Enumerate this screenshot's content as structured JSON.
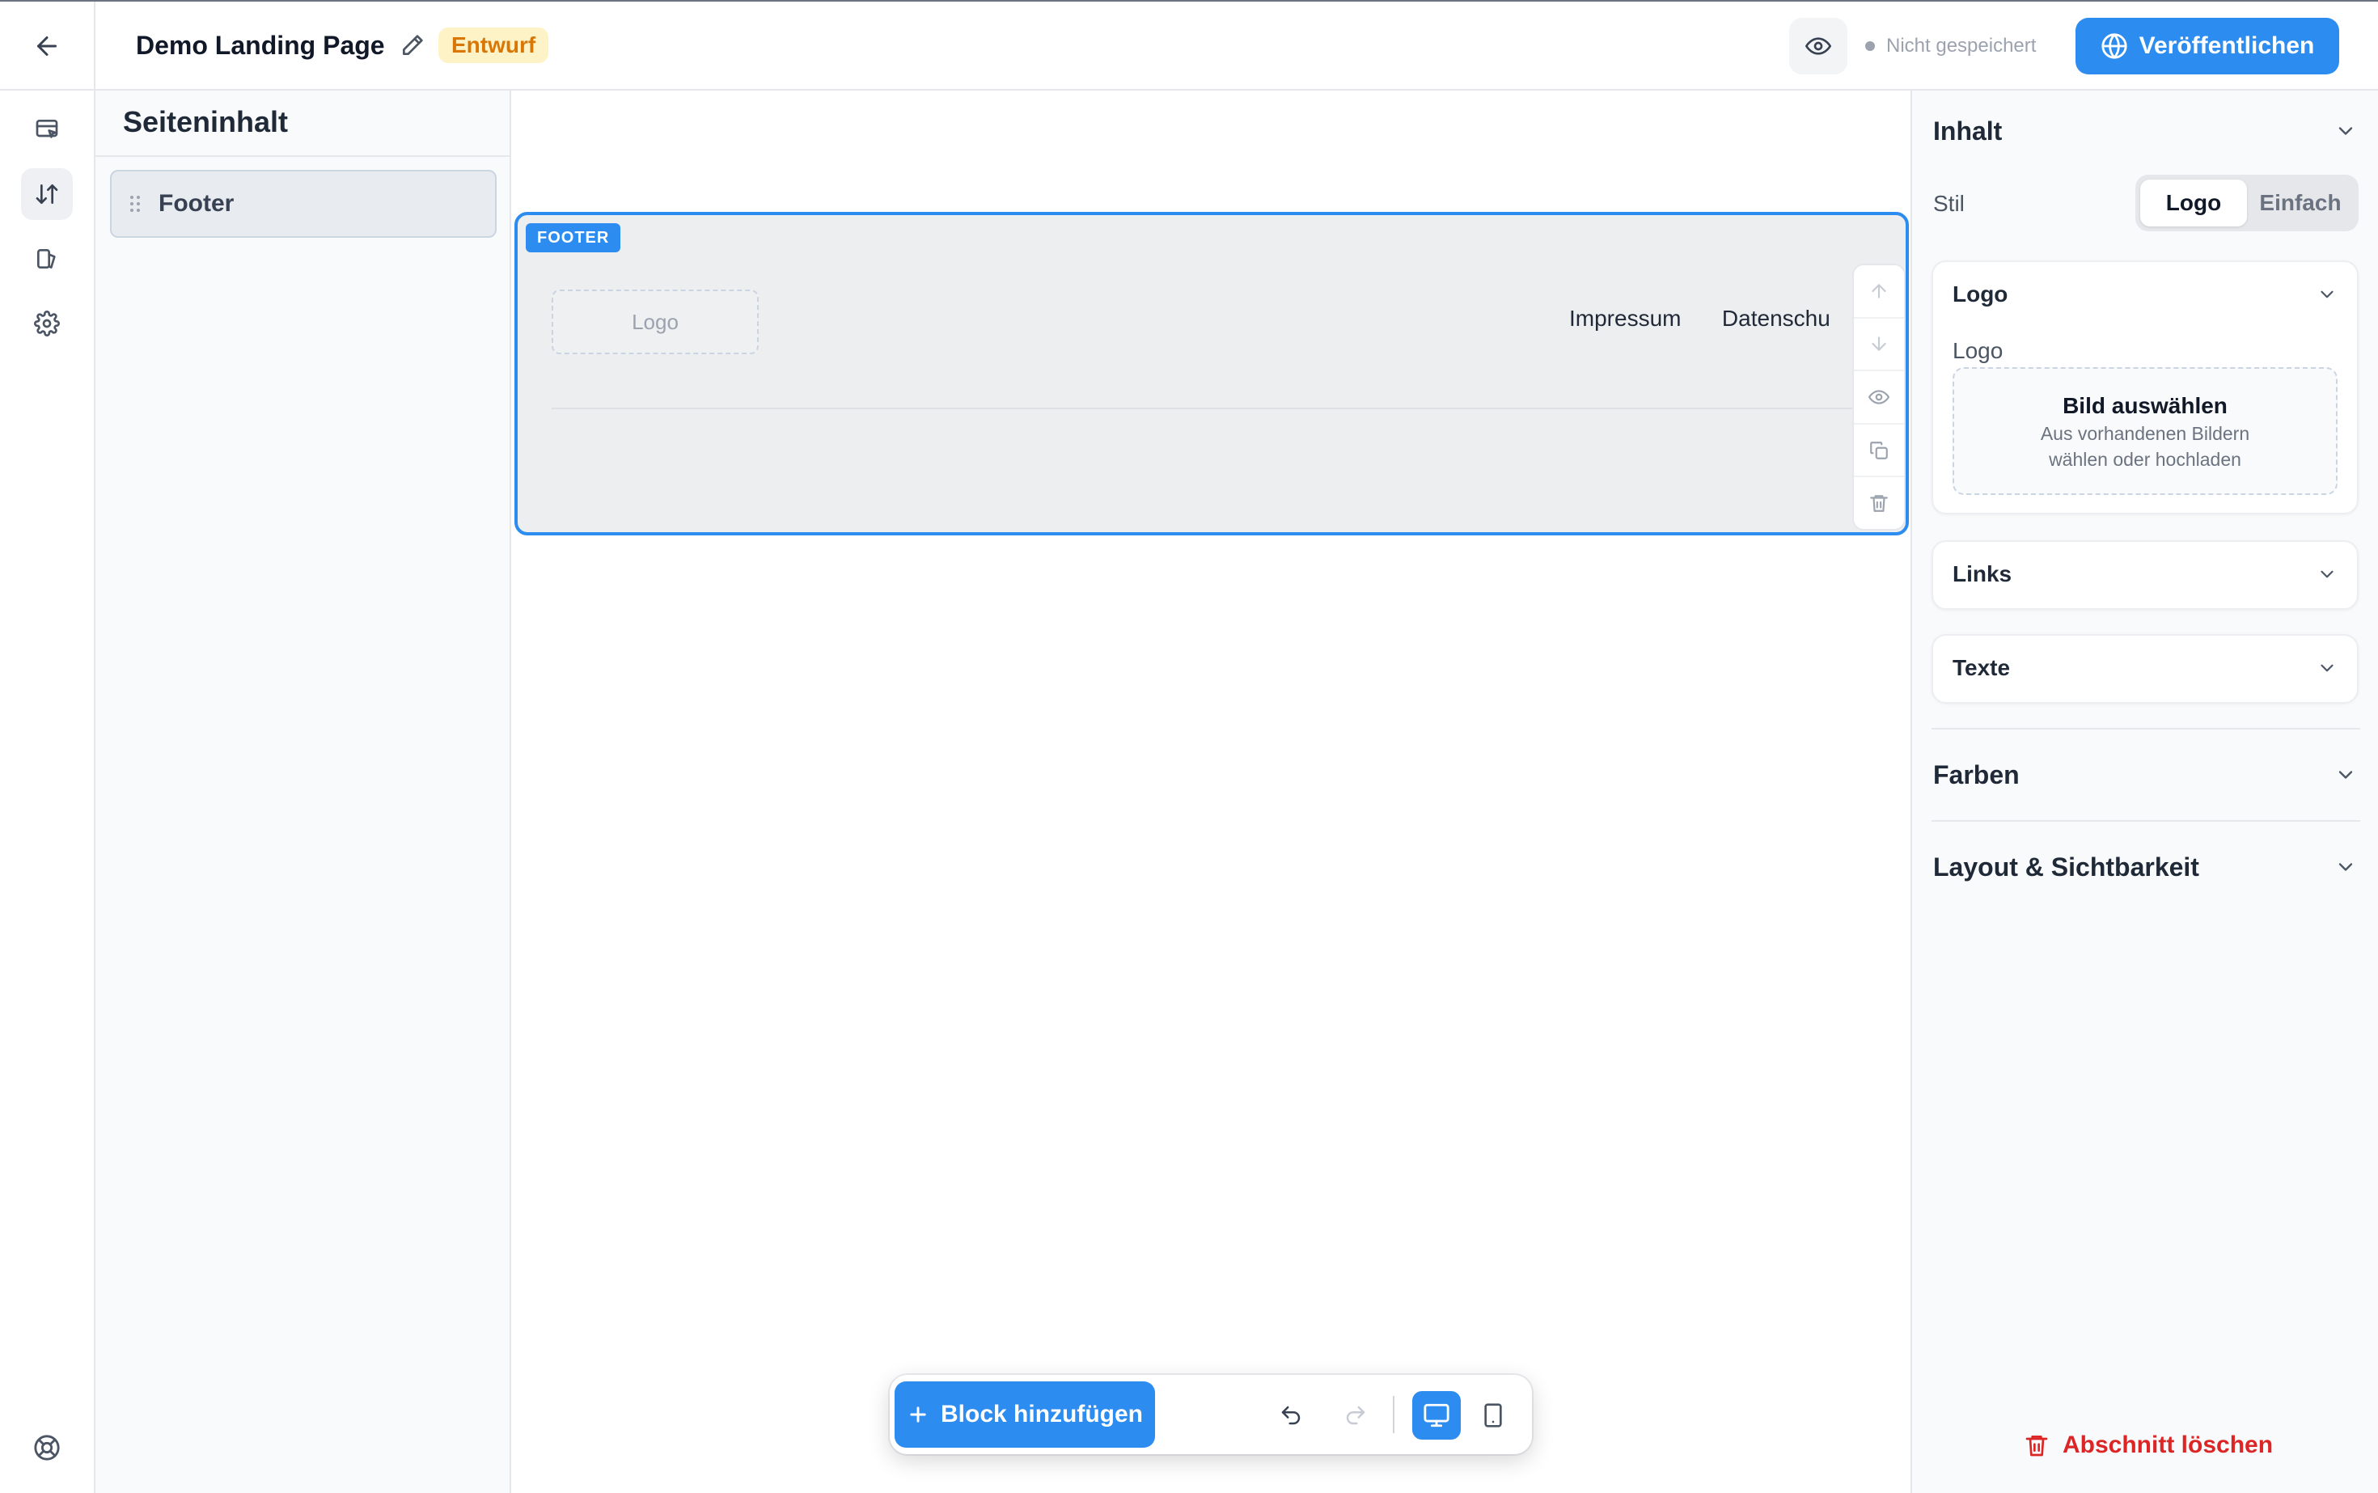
{
  "header": {
    "page_title": "Demo Landing Page",
    "status_badge": "Entwurf",
    "save_status": "Nicht gespeichert",
    "publish_label": "Veröffentlichen"
  },
  "structure_panel": {
    "title": "Seiteninhalt",
    "items": [
      {
        "label": "Footer"
      }
    ]
  },
  "canvas": {
    "block_tag": "FOOTER",
    "logo_placeholder": "Logo",
    "links": [
      "Impressum",
      "Datenschu"
    ]
  },
  "toolbar": {
    "add_block_label": "Block hinzufügen"
  },
  "properties": {
    "inhalt": {
      "title": "Inhalt",
      "stil_label": "Stil",
      "stil_options": [
        "Logo",
        "Einfach"
      ],
      "stil_selected": "Logo",
      "logo_card": {
        "title": "Logo",
        "field_label": "Logo",
        "dropzone_title": "Bild auswählen",
        "dropzone_subtitle": "Aus vorhandenen Bildern wählen oder hochladen"
      },
      "links_card": {
        "title": "Links"
      },
      "texte_card": {
        "title": "Texte"
      }
    },
    "farben": {
      "title": "Farben"
    },
    "layout": {
      "title": "Layout & Sichtbarkeit"
    },
    "delete_label": "Abschnitt löschen"
  },
  "colors": {
    "accent": "#2d8cf0",
    "draft_badge_bg": "#fef3c7",
    "draft_badge_text": "#d97706",
    "danger": "#dc2626"
  },
  "icons": {
    "back": "arrow-left-icon",
    "edit": "pencil-icon",
    "preview": "eye-icon",
    "publish": "globe-icon",
    "rail": [
      "page-cursor-icon",
      "sort-arrows-icon",
      "layers-icon",
      "gear-icon",
      "lifebuoy-icon"
    ],
    "block_tools": [
      "arrow-up-icon",
      "arrow-down-icon",
      "eye-icon",
      "copy-icon",
      "trash-icon"
    ],
    "toolbar": [
      "plus-icon",
      "undo-icon",
      "redo-icon",
      "desktop-icon",
      "tablet-icon"
    ]
  }
}
